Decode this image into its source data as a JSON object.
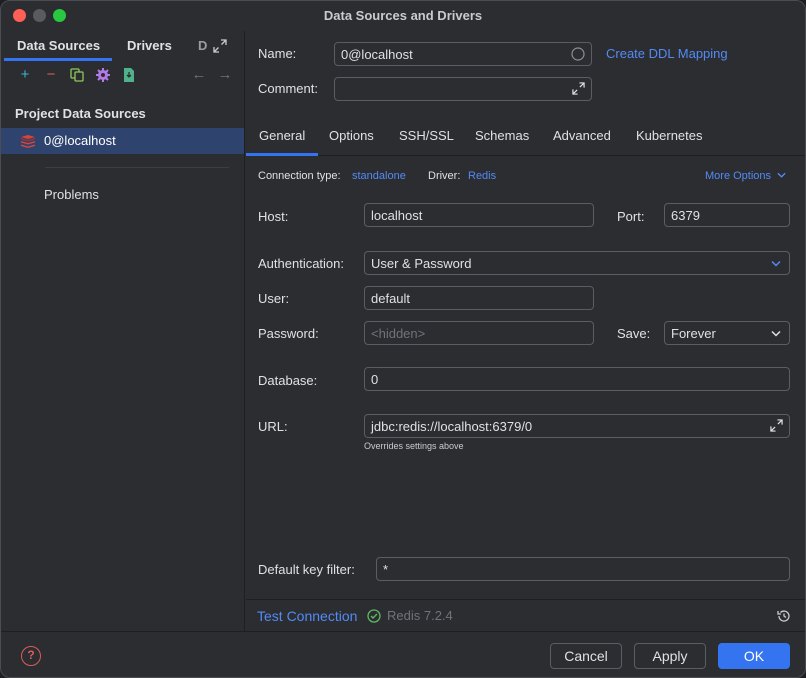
{
  "window": {
    "title": "Data Sources and Drivers"
  },
  "sidebar": {
    "tabs": [
      "Data Sources",
      "Drivers",
      "D"
    ],
    "section_title": "Project Data Sources",
    "selected_item": "0@localhost",
    "problems_label": "Problems",
    "toolbar_icons": [
      "add-icon",
      "remove-icon",
      "duplicate-icon",
      "settings-icon",
      "import-icon",
      "back-icon",
      "forward-icon"
    ]
  },
  "form": {
    "name_label": "Name:",
    "name_value": "0@localhost",
    "ddl_link": "Create DDL Mapping",
    "comment_label": "Comment:",
    "comment_value": ""
  },
  "tabs": [
    "General",
    "Options",
    "SSH/SSL",
    "Schemas",
    "Advanced",
    "Kubernetes"
  ],
  "general": {
    "connection_type_label": "Connection type:",
    "connection_type_value": "standalone",
    "driver_label": "Driver:",
    "driver_value": "Redis",
    "more_options": "More Options",
    "host_label": "Host:",
    "host_value": "localhost",
    "port_label": "Port:",
    "port_value": "6379",
    "auth_label": "Authentication:",
    "auth_value": "User & Password",
    "user_label": "User:",
    "user_value": "default",
    "password_label": "Password:",
    "password_placeholder": "<hidden>",
    "save_label": "Save:",
    "save_value": "Forever",
    "database_label": "Database:",
    "database_value": "0",
    "url_label": "URL:",
    "url_value": "jdbc:redis://localhost:6379/0",
    "url_hint": "Overrides settings above",
    "key_filter_label": "Default key filter:",
    "key_filter_value": "*"
  },
  "status": {
    "test_connection": "Test Connection",
    "server_version": "Redis 7.2.4"
  },
  "footer": {
    "help": "?",
    "cancel": "Cancel",
    "apply": "Apply",
    "ok": "OK"
  },
  "colors": {
    "accent": "#3574f0",
    "link": "#548af7",
    "selection": "#2e436e",
    "success": "#5fb865",
    "redis": "#d6443a"
  }
}
